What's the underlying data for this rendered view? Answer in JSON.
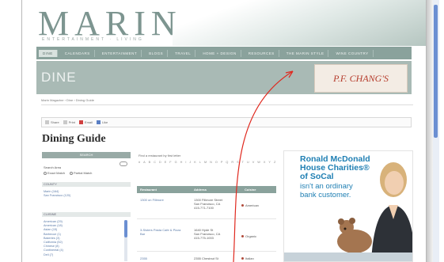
{
  "site": {
    "logo": "MARIN",
    "tagline": "ENTERTAINMENT · LIVING"
  },
  "nav": {
    "items": [
      "DINE",
      "CALENDARS",
      "ENTERTAINMENT",
      "BLOGS",
      "TRAVEL",
      "HOME + DESIGN",
      "RESOURCES",
      "THE MARIN STYLE",
      "WINE COUNTRY"
    ]
  },
  "section": {
    "title": "DINE"
  },
  "ad_banner": {
    "text": "P.F. CHANG'S"
  },
  "breadcrumb": "Marin Magazine  ›  Dine  ›  Dining Guide",
  "share": {
    "items": [
      "Share",
      "Print",
      "Email",
      "Like"
    ]
  },
  "page": {
    "title": "Dining Guide"
  },
  "sidebar": {
    "search_header": "SEARCH",
    "search_label": "Search Area",
    "radio_options": [
      "Exact Match",
      "Partial Match"
    ],
    "county_header": "COUNTY",
    "counties": [
      "Marin (164)",
      "San Francisco (120)"
    ],
    "cuisine_header": "CUISINE",
    "cuisines": [
      "American (29)",
      "American (18)",
      "Asian (15)",
      "Barbecue (1)",
      "Bakeries (3)",
      "California (52)",
      "Chinese (8)",
      "Continental (4)",
      "Deli (7)"
    ]
  },
  "guide": {
    "alpha_label": "Find a restaurant by first letter",
    "letters": [
      "#",
      "A",
      "B",
      "C",
      "D",
      "E",
      "F",
      "G",
      "H",
      "I",
      "J",
      "K",
      "L",
      "M",
      "N",
      "O",
      "P",
      "Q",
      "R",
      "S",
      "T",
      "U",
      "V",
      "W",
      "X",
      "Y",
      "Z"
    ],
    "columns": [
      "Restaurant",
      "Address",
      "Cuisine"
    ],
    "rows": [
      {
        "name": "1300 on Fillmore",
        "address": [
          "1300 Fillmore Street",
          "San Francisco, CA",
          "415-771-7100"
        ],
        "cuisine": "American"
      },
      {
        "name": "3-Sisters Pasta Cafe & Pizza Bar",
        "address": [
          "1640 Hyde St",
          "San Francisco, CA",
          "415-775-1003"
        ],
        "cuisine": "Organic"
      },
      {
        "name": "2355",
        "address": [
          "2355 Chestnut St"
        ],
        "cuisine": "Italian"
      }
    ]
  },
  "right_ad": {
    "headline": "Ronald McDonald House Charities® of SoCal",
    "sub": "isn't an ordinary bank customer."
  },
  "colors": {
    "nav": "#8aa29c",
    "header_band": "#a9bab5",
    "link": "#5a7aa8",
    "annotation_arrow": "#e0291f"
  }
}
